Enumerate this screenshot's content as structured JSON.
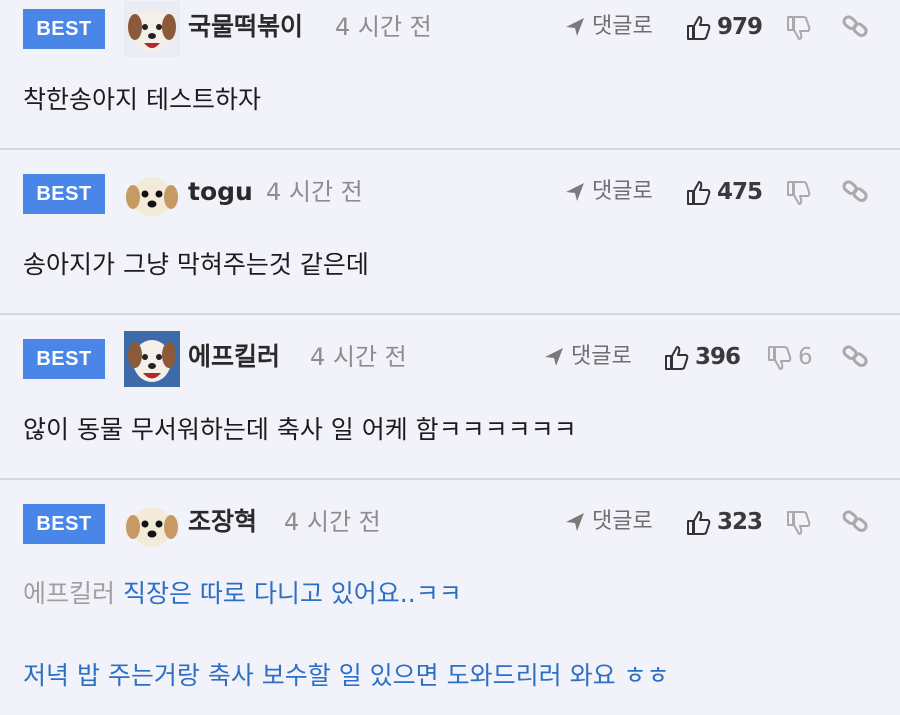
{
  "badge_label": "BEST",
  "reply_label": "댓글로",
  "comments": [
    {
      "nick": "국물떡볶이",
      "time": "4 시간 전",
      "likes": "979",
      "dislikes": "",
      "avatar": "dog-portrait-icon",
      "lines": [
        "착한송아지 테스트하자"
      ]
    },
    {
      "nick": "togu",
      "time": "4 시간 전",
      "likes": "475",
      "dislikes": "",
      "avatar": "puppy-face-icon",
      "lines": [
        "송아지가 그냥 막혀주는것 같은데"
      ]
    },
    {
      "nick": "에프킬러",
      "time": "4 시간 전",
      "likes": "396",
      "dislikes": "6",
      "avatar": "dog-portrait-icon",
      "lines": [
        "않이 동물 무서워하는데 축사 일 어케 함ㅋㅋㅋㅋㅋㅋ"
      ]
    },
    {
      "nick": "조장혁",
      "time": "4 시간 전",
      "likes": "323",
      "dislikes": "",
      "avatar": "puppy-face-icon",
      "mention": "에프킬러",
      "lines": [
        "직장은 따로 다니고 있어요..ㅋㅋ",
        "저녁 밥 주는거랑 축사 보수할 일 있으면 도와드리러 와요 ㅎㅎ"
      ]
    }
  ],
  "colors": {
    "background": "#f2f3fa",
    "badge": "#4a86e8",
    "reply_text": "#2d6fc4",
    "divider": "#d6d7de"
  }
}
